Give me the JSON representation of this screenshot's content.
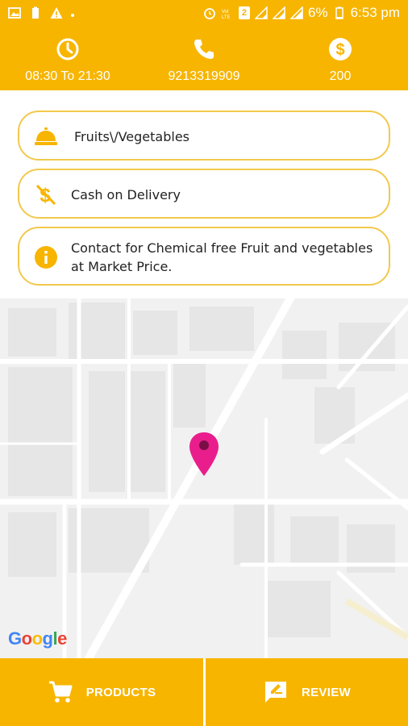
{
  "status_bar": {
    "battery_percent": "6%",
    "time": "6:53 pm",
    "sim_badge": "2"
  },
  "header": {
    "hours": "08:30 To 21:30",
    "phone": "9213319909",
    "amount": "200",
    "icons": [
      "clock-icon",
      "phone-icon",
      "dollar-icon"
    ]
  },
  "cards": [
    {
      "icon": "food-cloche-icon",
      "text": "Fruits\\/Vegetables"
    },
    {
      "icon": "dollar-strike-icon",
      "text": "Cash on Delivery"
    },
    {
      "icon": "info-icon",
      "text": "Contact for Chemical free Fruit and vegetables at Market Price."
    }
  ],
  "map": {
    "attribution": "Google",
    "marker_color": "#e91e8c"
  },
  "bottom_nav": {
    "products_label": "PRODUCTS",
    "review_label": "REVIEW"
  },
  "colors": {
    "accent": "#f7b500",
    "card_border": "#f2c94c"
  }
}
